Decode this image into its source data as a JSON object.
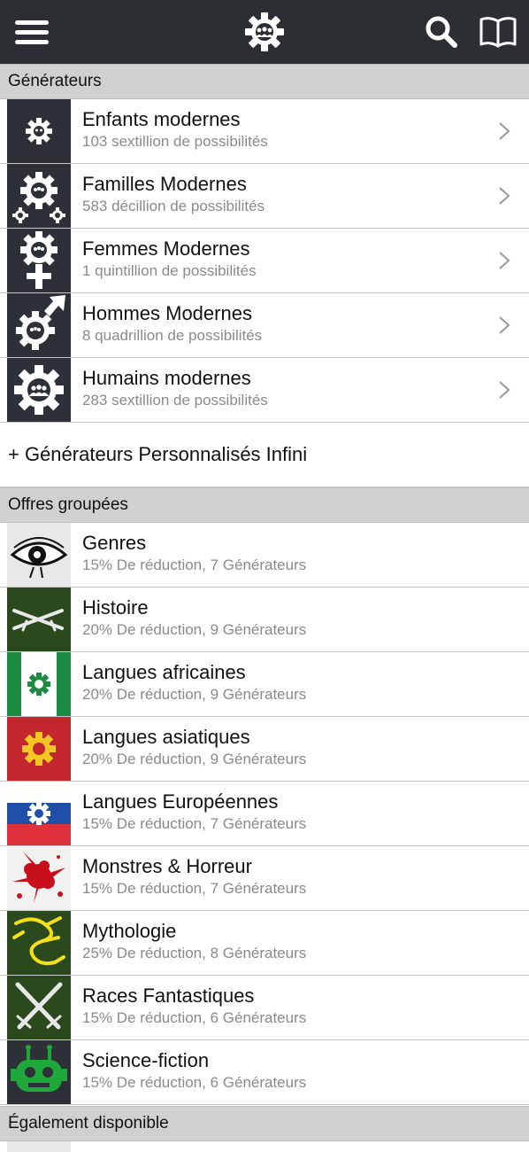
{
  "header": {
    "menu_icon": "hamburger-icon",
    "logo_icon": "gear-people-logo-icon",
    "search_icon": "search-icon",
    "book_icon": "open-book-icon"
  },
  "sections": {
    "generators": "Générateurs",
    "bundles": "Offres groupées",
    "also": "Également disponible"
  },
  "generators": [
    {
      "title": "Enfants modernes",
      "subtitle": "103 sextillion de possibilités",
      "icon": "small-gear-people-icon"
    },
    {
      "title": "Familles Modernes",
      "subtitle": "583 décillion de possibilités",
      "icon": "gear-family-icon"
    },
    {
      "title": "Femmes Modernes",
      "subtitle": "1 quintillion de possibilités",
      "icon": "gear-female-symbol-icon"
    },
    {
      "title": "Hommes Modernes",
      "subtitle": "8 quadrillion de possibilités",
      "icon": "gear-male-symbol-icon"
    },
    {
      "title": "Humains modernes",
      "subtitle": "283 sextillion de possibilités",
      "icon": "gear-people-icon"
    }
  ],
  "custom_generators": "+ Générateurs Personnalisés Infini",
  "bundles": [
    {
      "title": "Genres",
      "subtitle": "15% De réduction, 7 Générateurs",
      "icon": "eye-icon"
    },
    {
      "title": "Histoire",
      "subtitle": "20% De réduction, 9 Générateurs",
      "icon": "crossed-rifles-icon"
    },
    {
      "title": "Langues africaines",
      "subtitle": "20% De réduction, 9 Générateurs",
      "icon": "green-white-flag-icon"
    },
    {
      "title": "Langues asiatiques",
      "subtitle": "20% De réduction, 9 Générateurs",
      "icon": "red-yellow-gear-icon"
    },
    {
      "title": "Langues Européennes",
      "subtitle": "15% De réduction, 7 Générateurs",
      "icon": "tricolor-flag-icon"
    },
    {
      "title": "Monstres & Horreur",
      "subtitle": "15% De réduction, 7 Générateurs",
      "icon": "blood-splatter-icon"
    },
    {
      "title": "Mythologie",
      "subtitle": "25% De réduction, 8 Générateurs",
      "icon": "dragon-icon"
    },
    {
      "title": "Races Fantastiques",
      "subtitle": "15% De réduction, 6 Générateurs",
      "icon": "crossed-swords-icon"
    },
    {
      "title": "Science-fiction",
      "subtitle": "15% De réduction, 6 Générateurs",
      "icon": "robot-icon"
    }
  ],
  "colors": {
    "topbar": "#2b2e33",
    "section_bg": "#d0d0d0",
    "subtitle": "#8a8a8a"
  }
}
